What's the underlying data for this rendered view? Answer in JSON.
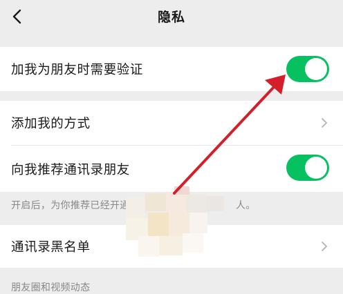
{
  "nav": {
    "title": "隐私",
    "back_icon": "chevron-left-icon"
  },
  "settings": {
    "verify_friend": {
      "label": "加我为朋友时需要验证",
      "enabled": true
    },
    "add_methods": {
      "label": "添加我的方式",
      "icon": "chevron-right-icon"
    },
    "recommend_contacts": {
      "label": "向我推荐通讯录朋友",
      "enabled": true,
      "hint_prefix": "开启后，为你推荐已经开通",
      "hint_suffix": "人。"
    },
    "blacklist": {
      "label": "通讯录黑名单",
      "icon": "chevron-right-icon"
    },
    "next_section_partial": "朋友圈和视频动态"
  },
  "colors": {
    "toggle_on": "#07c160",
    "annotation_arrow": "#d41e2a",
    "background": "#ededed"
  }
}
